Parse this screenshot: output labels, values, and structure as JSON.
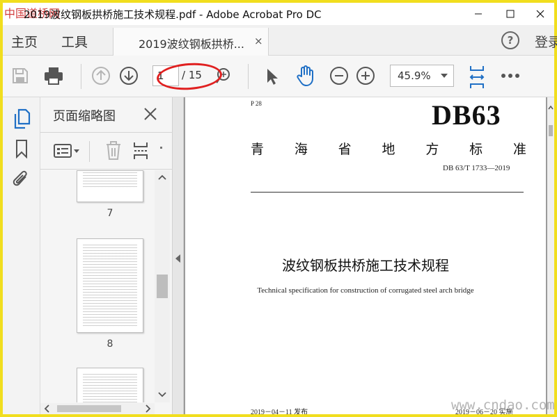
{
  "window": {
    "title": "2019波纹钢板拱桥施工技术规程.pdf - Adobe Acrobat Pro DC",
    "logo_text": "中国道桥网"
  },
  "menu": {
    "home": "主页",
    "tools": "工具",
    "tab_label": "2019波纹钢板拱桥...",
    "tab_close": "×",
    "help": "?",
    "login": "登录"
  },
  "toolbar": {
    "current_page": "1",
    "page_total": "/ 15",
    "zoom": "45.9%"
  },
  "thumbnails": {
    "panel_title": "页面缩略图",
    "pages": [
      {
        "number": "7"
      },
      {
        "number": "8"
      },
      {
        "number": ""
      }
    ]
  },
  "document": {
    "ics_code": "P 28",
    "standard_mark": "DB63",
    "region_chars": [
      "青",
      "海",
      "省",
      "地",
      "方",
      "标",
      "准"
    ],
    "standard_number": "DB 63/T  1733—2019",
    "title_zh": "波纹钢板拱桥施工技术规程",
    "title_en": "Technical specification for construction of corrugated steel arch bridge",
    "issue_date": "2019－04－11 发布",
    "impl_date": "2019－06－20 实施"
  },
  "watermark": "www.cndao.com",
  "colors": {
    "accent_blue": "#1f6fc5",
    "annotation_red": "#e02020",
    "frame_yellow": "#f1de1e"
  }
}
